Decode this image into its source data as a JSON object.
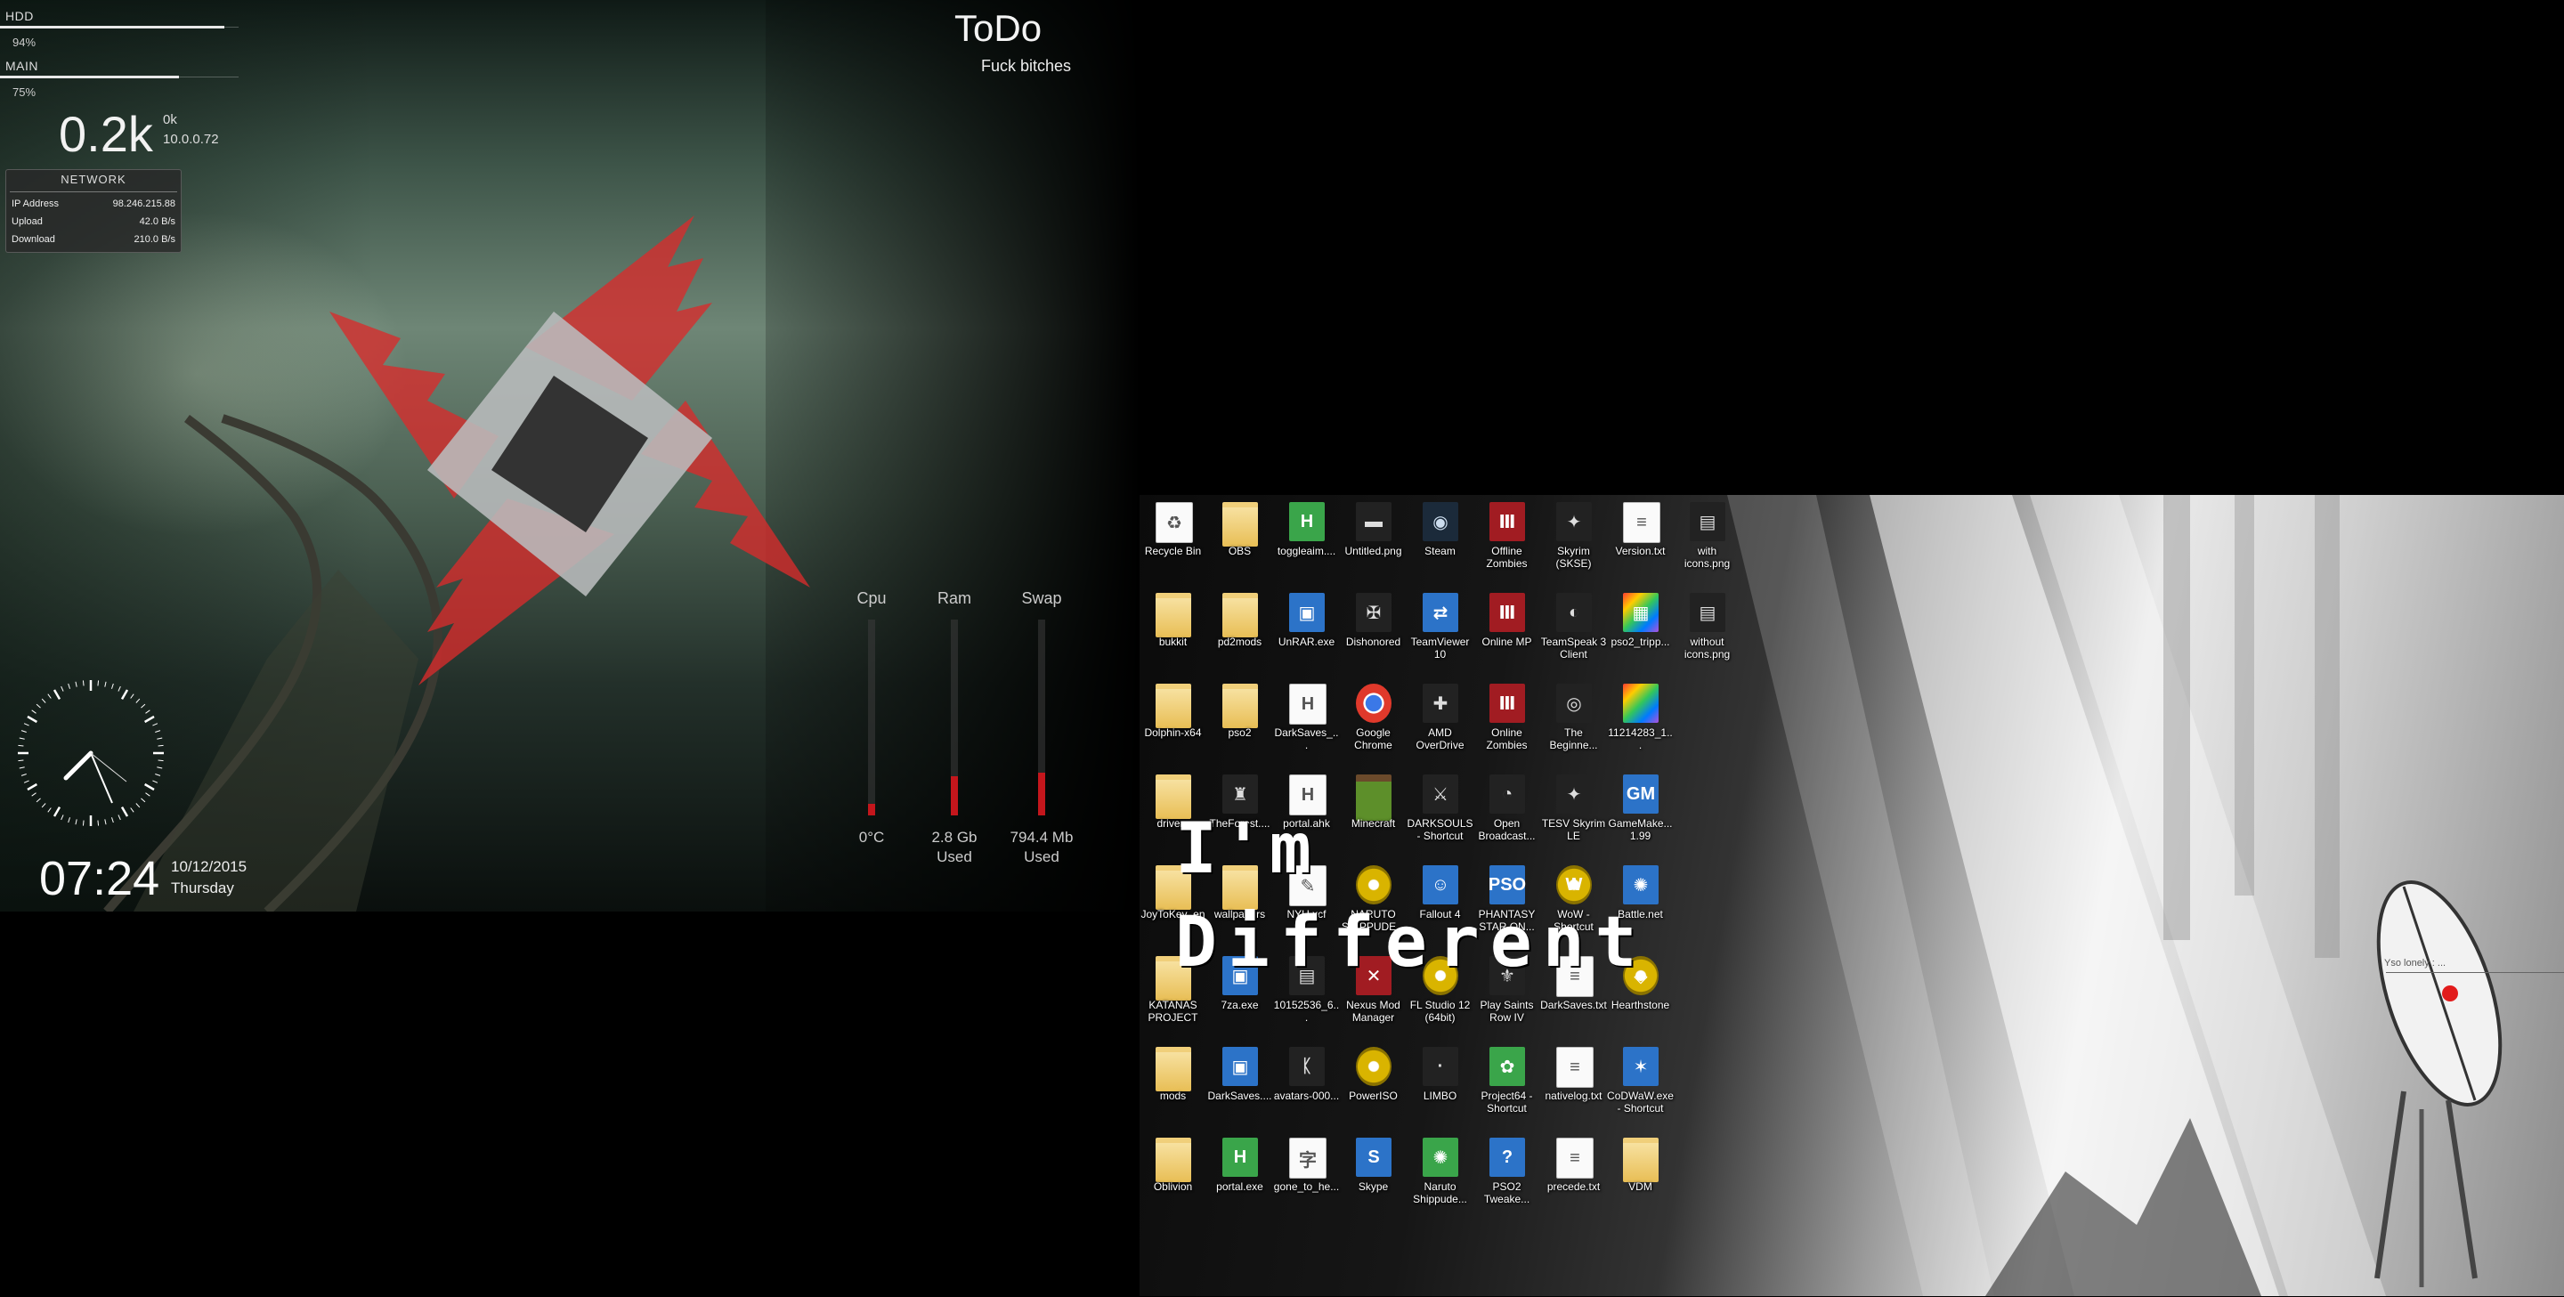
{
  "system_meters": {
    "hdd": {
      "label": "HDD",
      "percent_text": "94%",
      "level": 0.94
    },
    "main": {
      "label": "MAIN",
      "percent_text": "75%",
      "level": 0.75
    }
  },
  "network_speed": {
    "big": "0.2k",
    "small_1": "0k",
    "small_2": "10.0.0.72"
  },
  "network_panel": {
    "title": "NETWORK",
    "rows": [
      {
        "key": "IP Address",
        "value": "98.246.215.88"
      },
      {
        "key": "Upload",
        "value": "42.0 B/s"
      },
      {
        "key": "Download",
        "value": "210.0 B/s"
      }
    ]
  },
  "todo": {
    "title": "ToDo",
    "subtitle": "Fuck bitches"
  },
  "clock": {
    "time": "07:24",
    "date": "10/12/2015",
    "day": "Thursday"
  },
  "resource_meters": [
    {
      "label": "Cpu",
      "value_line1": "0°C",
      "value_line2": "",
      "level": 0.06
    },
    {
      "label": "Ram",
      "value_line1": "2.8 Gb",
      "value_line2": "Used",
      "level": 0.2
    },
    {
      "label": "Swap",
      "value_line1": "794.4 Mb",
      "value_line2": "Used",
      "level": 0.22
    }
  ],
  "desktop_icons": [
    [
      {
        "label": "Recycle Bin",
        "icon": "recycle-bin-icon",
        "style": "doc",
        "glyph": "♻"
      },
      {
        "label": "OBS",
        "icon": "folder-icon",
        "style": "folder",
        "glyph": ""
      },
      {
        "label": "toggleaim....",
        "icon": "autohotkey-icon",
        "style": "green",
        "glyph": "H"
      },
      {
        "label": "Untitled.png",
        "icon": "image-file-icon",
        "style": "dark",
        "glyph": "▬"
      },
      {
        "label": "Steam",
        "icon": "steam-icon",
        "style": "steam",
        "glyph": "◉"
      },
      {
        "label": "Offline Zombies",
        "icon": "game-icon",
        "style": "red",
        "glyph": "Ⅲ"
      },
      {
        "label": "Skyrim (SKSE)",
        "icon": "skyrim-icon",
        "style": "dark",
        "glyph": "✦"
      },
      {
        "label": "Version.txt",
        "icon": "text-file-icon",
        "style": "doc",
        "glyph": "≡"
      },
      {
        "label": "with icons.png",
        "icon": "image-file-icon",
        "style": "dark",
        "glyph": "▤"
      }
    ],
    [
      {
        "label": "bukkit",
        "icon": "folder-icon",
        "style": "folder",
        "glyph": ""
      },
      {
        "label": "pd2mods",
        "icon": "folder-icon",
        "style": "folder",
        "glyph": ""
      },
      {
        "label": "UnRAR.exe",
        "icon": "exe-icon",
        "style": "blue",
        "glyph": "▣"
      },
      {
        "label": "Dishonored",
        "icon": "dishonored-icon",
        "style": "dark",
        "glyph": "✠"
      },
      {
        "label": "TeamViewer 10",
        "icon": "teamviewer-icon",
        "style": "blue",
        "glyph": "⇄"
      },
      {
        "label": "Online MP",
        "icon": "game-icon",
        "style": "red",
        "glyph": "Ⅲ"
      },
      {
        "label": "TeamSpeak 3 Client",
        "icon": "teamspeak-icon",
        "style": "dark",
        "glyph": "◐"
      },
      {
        "label": "pso2_tripp...",
        "icon": "archive-icon",
        "style": "multi",
        "glyph": "▦"
      },
      {
        "label": "without icons.png",
        "icon": "image-file-icon",
        "style": "dark",
        "glyph": "▤"
      }
    ],
    [
      {
        "label": "Dolphin-x64",
        "icon": "folder-icon",
        "style": "folder",
        "glyph": ""
      },
      {
        "label": "pso2",
        "icon": "folder-icon",
        "style": "folder",
        "glyph": ""
      },
      {
        "label": "DarkSaves_...",
        "icon": "autohotkey-icon",
        "style": "doc",
        "glyph": "H"
      },
      {
        "label": "Google Chrome",
        "icon": "chrome-icon",
        "style": "chrome",
        "glyph": ""
      },
      {
        "label": "AMD OverDrive",
        "icon": "amd-icon",
        "style": "dark",
        "glyph": "✚"
      },
      {
        "label": "Online Zombies",
        "icon": "game-icon",
        "style": "red",
        "glyph": "Ⅲ"
      },
      {
        "label": "The Beginne...",
        "icon": "game-icon",
        "style": "dark",
        "glyph": "◎"
      },
      {
        "label": "11214283_1...",
        "icon": "image-file-icon",
        "style": "multi",
        "glyph": ""
      }
    ],
    [
      {
        "label": "drivers",
        "icon": "folder-icon",
        "style": "folder",
        "glyph": ""
      },
      {
        "label": "TheForest....",
        "icon": "game-icon",
        "style": "dark",
        "glyph": "♜"
      },
      {
        "label": "portal.ahk",
        "icon": "autohotkey-icon",
        "style": "doc",
        "glyph": "H"
      },
      {
        "label": "Minecraft",
        "icon": "minecraft-icon",
        "style": "mine",
        "glyph": ""
      },
      {
        "label": "DARKSOULS - Shortcut",
        "icon": "game-icon",
        "style": "dark",
        "glyph": "⚔"
      },
      {
        "label": "Open Broadcast...",
        "icon": "obs-icon",
        "style": "dark",
        "glyph": "◔"
      },
      {
        "label": "TESV Skyrim LE",
        "icon": "skyrim-icon",
        "style": "dark",
        "glyph": "✦"
      },
      {
        "label": "GameMake... 1.99",
        "icon": "gamemaker-icon",
        "style": "blue",
        "glyph": "GM"
      }
    ],
    [
      {
        "label": "JoyToKey_en",
        "icon": "folder-icon",
        "style": "folder",
        "glyph": ""
      },
      {
        "label": "wallpapers",
        "icon": "folder-icon",
        "style": "folder",
        "glyph": ""
      },
      {
        "label": "NYU.xcf",
        "icon": "gimp-icon",
        "style": "doc",
        "glyph": "✎"
      },
      {
        "label": "NARUTO SHIPPUDE...",
        "icon": "naruto-icon",
        "style": "gold",
        "glyph": ""
      },
      {
        "label": "Fallout 4",
        "icon": "fallout-icon",
        "style": "blue",
        "glyph": "☺"
      },
      {
        "label": "PHANTASY STAR ON...",
        "icon": "pso-icon",
        "style": "blue",
        "glyph": "PSO"
      },
      {
        "label": "WoW - Shortcut",
        "icon": "wow-icon",
        "style": "gold",
        "glyph": "W"
      },
      {
        "label": "Battle.net",
        "icon": "battlenet-icon",
        "style": "blue",
        "glyph": "✺"
      }
    ],
    [
      {
        "label": "KATANAS PROJECT",
        "icon": "folder-icon",
        "style": "folder",
        "glyph": ""
      },
      {
        "label": "7za.exe",
        "icon": "exe-icon",
        "style": "blue",
        "glyph": "▣"
      },
      {
        "label": "10152536_6...",
        "icon": "image-file-icon",
        "style": "dark",
        "glyph": "▤"
      },
      {
        "label": "Nexus Mod Manager",
        "icon": "nexus-icon",
        "style": "red",
        "glyph": "✕"
      },
      {
        "label": "FL Studio 12 (64bit)",
        "icon": "flstudio-icon",
        "style": "gold",
        "glyph": "♪"
      },
      {
        "label": "Play Saints Row IV",
        "icon": "game-icon",
        "style": "dark",
        "glyph": "⚜"
      },
      {
        "label": "DarkSaves.txt",
        "icon": "text-file-icon",
        "style": "doc",
        "glyph": "≡"
      },
      {
        "label": "Hearthstone",
        "icon": "hearthstone-icon",
        "style": "gold",
        "glyph": "◈"
      }
    ],
    [
      {
        "label": "mods",
        "icon": "folder-icon",
        "style": "folder",
        "glyph": ""
      },
      {
        "label": "DarkSaves....",
        "icon": "exe-icon",
        "style": "blue",
        "glyph": "▣"
      },
      {
        "label": "avatars-000...",
        "icon": "image-file-icon",
        "style": "dark",
        "glyph": "ᛕ"
      },
      {
        "label": "PowerISO",
        "icon": "poweriso-icon",
        "style": "gold",
        "glyph": ""
      },
      {
        "label": "LIMBO",
        "icon": "limbo-icon",
        "style": "dark",
        "glyph": "·"
      },
      {
        "label": "Project64 - Shortcut",
        "icon": "project64-icon",
        "style": "green",
        "glyph": "✿"
      },
      {
        "label": "nativelog.txt",
        "icon": "text-file-icon",
        "style": "doc",
        "glyph": "≡"
      },
      {
        "label": "CoDWaW.exe - Shortcut",
        "icon": "cod-icon",
        "style": "blue",
        "glyph": "✶"
      }
    ],
    [
      {
        "label": "Oblivion",
        "icon": "folder-icon",
        "style": "folder",
        "glyph": ""
      },
      {
        "label": "portal.exe",
        "icon": "autohotkey-icon",
        "style": "green",
        "glyph": "H"
      },
      {
        "label": "gone_to_he...",
        "icon": "image-file-icon",
        "style": "doc",
        "glyph": "字"
      },
      {
        "label": "Skype",
        "icon": "skype-icon",
        "style": "blue",
        "glyph": "S"
      },
      {
        "label": "Naruto Shippude...",
        "icon": "naruto-icon",
        "style": "green",
        "glyph": "✺"
      },
      {
        "label": "PSO2 Tweake...",
        "icon": "pso-icon",
        "style": "blue",
        "glyph": "?"
      },
      {
        "label": "precede.txt",
        "icon": "text-file-icon",
        "style": "doc",
        "glyph": "≡"
      },
      {
        "label": "VDM",
        "icon": "folder-icon",
        "style": "folder",
        "glyph": ""
      }
    ]
  ],
  "overlay_text": {
    "line1": "I'm",
    "line2": "Different"
  },
  "wallpaper_callout": "Yso lonely : ...",
  "colors": {
    "meter_red": "#c4161c",
    "logo_red": "#d92b2b",
    "logo_grey": "#b9bcbd",
    "logo_dark": "#333333"
  }
}
